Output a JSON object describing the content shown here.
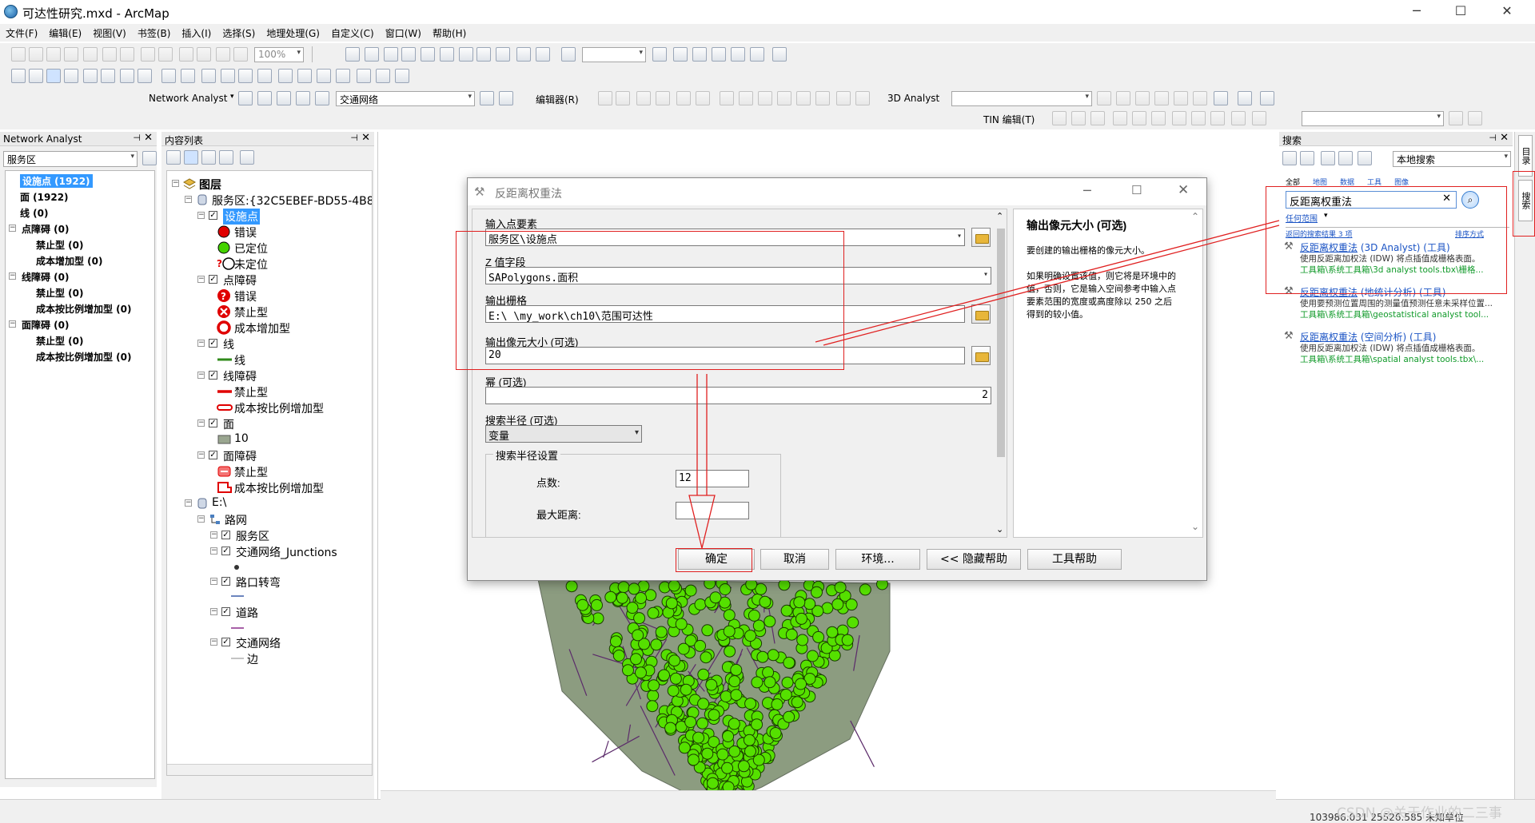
{
  "window": {
    "title": "可达性研究.mxd - ArcMap",
    "min": "─",
    "max": "☐",
    "close": "✕"
  },
  "menu": [
    "文件(F)",
    "编辑(E)",
    "视图(V)",
    "书签(B)",
    "插入(I)",
    "选择(S)",
    "地理处理(G)",
    "自定义(C)",
    "窗口(W)",
    "帮助(H)"
  ],
  "toolbar": {
    "zoom": "100%",
    "network_analyst_label": "Network Analyst",
    "network_combo": "交通网络",
    "editor_label": "编辑器(R)",
    "analyst3d_label": "3D Analyst",
    "tin_label": "TIN 编辑(T)"
  },
  "na_panel": {
    "title": "Network Analyst",
    "layer": "服务区",
    "items": [
      {
        "label": "设施点 (1922)",
        "level": 0,
        "selected": true
      },
      {
        "label": "面 (1922)",
        "level": 0
      },
      {
        "label": "线 (0)",
        "level": 0
      },
      {
        "label": "点障碍 (0)",
        "level": 0,
        "toggle": true
      },
      {
        "label": "禁止型 (0)",
        "level": 1
      },
      {
        "label": "成本增加型 (0)",
        "level": 1
      },
      {
        "label": "线障碍 (0)",
        "level": 0,
        "toggle": true
      },
      {
        "label": "禁止型 (0)",
        "level": 1
      },
      {
        "label": "成本按比例增加型 (0)",
        "level": 1
      },
      {
        "label": "面障碍 (0)",
        "level": 0,
        "toggle": true
      },
      {
        "label": "禁止型 (0)",
        "level": 1
      },
      {
        "label": "成本按比例增加型 (0)",
        "level": 1
      }
    ]
  },
  "toc": {
    "title": "内容列表",
    "items": [
      {
        "text": "图层",
        "indent": 0,
        "kind": "layers",
        "bold": true
      },
      {
        "text": "服务区:{32C5EBEF-BD55-4B8",
        "indent": 1,
        "kind": "db"
      },
      {
        "text": "设施点",
        "indent": 2,
        "kind": "chk",
        "selected": true
      },
      {
        "text": "错误",
        "indent": 3,
        "kind": "sym",
        "sym": "redcircle"
      },
      {
        "text": "已定位",
        "indent": 3,
        "kind": "sym",
        "sym": "greencircle"
      },
      {
        "text": "未定位",
        "indent": 3,
        "kind": "sym",
        "sym": "qcircle"
      },
      {
        "text": "点障碍",
        "indent": 2,
        "kind": "chk"
      },
      {
        "text": "错误",
        "indent": 3,
        "kind": "sym",
        "sym": "redq"
      },
      {
        "text": "禁止型",
        "indent": 3,
        "kind": "sym",
        "sym": "redx"
      },
      {
        "text": "成本增加型",
        "indent": 3,
        "kind": "sym",
        "sym": "redring"
      },
      {
        "text": "线",
        "indent": 2,
        "kind": "chk"
      },
      {
        "text": "线",
        "indent": 3,
        "kind": "sym",
        "sym": "greenline"
      },
      {
        "text": "线障碍",
        "indent": 2,
        "kind": "chk"
      },
      {
        "text": "禁止型",
        "indent": 3,
        "kind": "sym",
        "sym": "redline"
      },
      {
        "text": "成本按比例增加型",
        "indent": 3,
        "kind": "sym",
        "sym": "redpill"
      },
      {
        "text": "面",
        "indent": 2,
        "kind": "chk"
      },
      {
        "text": "10",
        "indent": 3,
        "kind": "sym",
        "sym": "greyrect"
      },
      {
        "text": "面障碍",
        "indent": 2,
        "kind": "chk"
      },
      {
        "text": "禁止型",
        "indent": 3,
        "kind": "sym",
        "sym": "redpoly"
      },
      {
        "text": "成本按比例增加型",
        "indent": 3,
        "kind": "sym",
        "sym": "redpoly2"
      },
      {
        "text": "E:\\",
        "indent": 1,
        "kind": "db"
      },
      {
        "text": "路网",
        "indent": 2,
        "kind": "net"
      },
      {
        "text": "服务区",
        "indent": 3,
        "kind": "chk"
      },
      {
        "text": "交通网络_Junctions",
        "indent": 3,
        "kind": "chk"
      },
      {
        "text": "",
        "indent": 4,
        "kind": "sym",
        "sym": "dot"
      },
      {
        "text": "路口转弯",
        "indent": 3,
        "kind": "chk"
      },
      {
        "text": "",
        "indent": 4,
        "kind": "sym",
        "sym": "blueline"
      },
      {
        "text": "道路",
        "indent": 3,
        "kind": "chk"
      },
      {
        "text": "",
        "indent": 4,
        "kind": "sym",
        "sym": "purpleline"
      },
      {
        "text": "交通网络",
        "indent": 3,
        "kind": "chk"
      },
      {
        "text": "边",
        "indent": 4,
        "kind": "sym",
        "sym": "edge"
      }
    ]
  },
  "dialog": {
    "title": "反距离权重法",
    "labels": {
      "input": "输入点要素",
      "zfield": "Z 值字段",
      "output": "输出栅格",
      "cellsize": "输出像元大小 (可选)",
      "power": "幂 (可选)",
      "radius": "搜索半径 (可选)",
      "radius_group": "搜索半径设置",
      "points": "点数:",
      "maxdist": "最大距离:"
    },
    "values": {
      "input": "服务区\\设施点",
      "zfield": "SAPolygons.面积",
      "output": "E:\\             \\my_work\\ch10\\范围可达性",
      "cellsize": "20",
      "power": "2",
      "radius": "变量",
      "points": "12",
      "maxdist": ""
    },
    "help": {
      "title": "输出像元大小 (可选)",
      "p1": "要创建的输出栅格的像元大小。",
      "p2": "如果明确设置该值，则它将是环境中的值，否则，它是输入空间参考中输入点要素范围的宽度或高度除以 250 之后得到的较小值。"
    },
    "buttons": {
      "ok": "确定",
      "cancel": "取消",
      "env": "环境...",
      "hidehelp": "<< 隐藏帮助",
      "toolhelp": "工具帮助"
    }
  },
  "search": {
    "title": "搜索",
    "scope": "本地搜索",
    "tabs": [
      "全部",
      "地图",
      "数据",
      "工具",
      "图像"
    ],
    "query": "反距离权重法",
    "anywhere": "任何范围",
    "results_count": "返回的搜索结果 3 项",
    "sort": "排序方式",
    "results": [
      {
        "name": "反距离权重法",
        "tag": "(3D Analyst) (工具)",
        "desc": "使用反距离加权法 (IDW) 将点插值成栅格表面。",
        "path": "工具箱\\系统工具箱\\3d analyst tools.tbx\\栅格..."
      },
      {
        "name": "反距离权重法",
        "tag": "(地统计分析) (工具)",
        "desc": "使用要预测位置周围的测量值预测任意未采样位置...",
        "path": "工具箱\\系统工具箱\\geostatistical analyst tool..."
      },
      {
        "name": "反距离权重法",
        "tag": "(空间分析) (工具)",
        "desc": "使用反距离加权法 (IDW) 将点插值成栅格表面。",
        "path": "工具箱\\系统工具箱\\spatial analyst tools.tbx\\..."
      }
    ]
  },
  "side_tabs": [
    "目录",
    "搜索"
  ],
  "status": {
    "coords": "103986.031  25526.585 未知单位",
    "watermark": "CSDN @关于作业的二三事"
  }
}
